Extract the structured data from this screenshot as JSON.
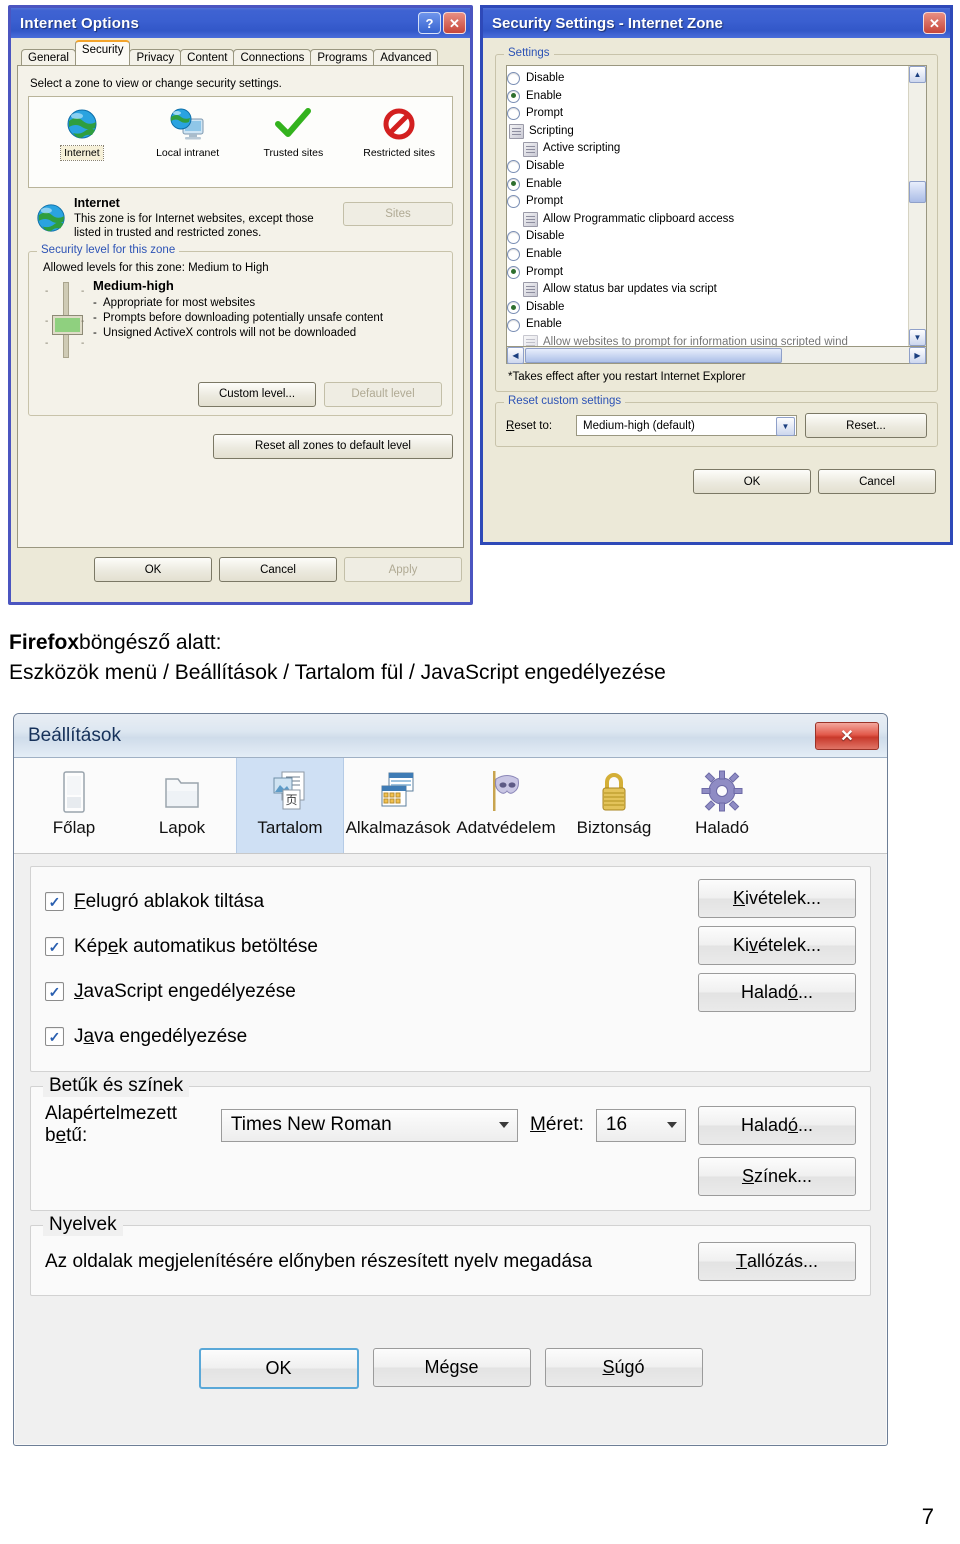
{
  "ie_options": {
    "title": "Internet Options",
    "help_button": "?",
    "close_button": "✕",
    "tabs": [
      {
        "label": "General",
        "active": false
      },
      {
        "label": "Security",
        "active": true
      },
      {
        "label": "Privacy",
        "active": false
      },
      {
        "label": "Content",
        "active": false
      },
      {
        "label": "Connections",
        "active": false
      },
      {
        "label": "Programs",
        "active": false
      },
      {
        "label": "Advanced",
        "active": false
      }
    ],
    "hint": "Select a zone to view or change security settings.",
    "zones": [
      {
        "label": "Internet",
        "icon": "globe-icon",
        "selected": true
      },
      {
        "label": "Local intranet",
        "icon": "globe-monitor-icon",
        "selected": false
      },
      {
        "label": "Trusted sites",
        "icon": "green-check-icon",
        "selected": false
      },
      {
        "label": "Restricted sites",
        "icon": "red-prohibited-icon",
        "selected": false
      }
    ],
    "zone_detail": {
      "name": "Internet",
      "description": "This zone is for Internet websites, except those listed in trusted and restricted zones.",
      "sites_button": "Sites"
    },
    "security_level": {
      "group_title": "Security level for this zone",
      "allowed": "Allowed levels for this zone: Medium to High",
      "level_name": "Medium-high",
      "bullets": [
        "Appropriate for most websites",
        "Prompts before downloading potentially unsafe content",
        "Unsigned ActiveX controls will not be downloaded"
      ],
      "custom_level_button": "Custom level...",
      "default_level_button": "Default level",
      "reset_all_button": "Reset all zones to default level"
    },
    "footer": {
      "ok": "OK",
      "cancel": "Cancel",
      "apply": "Apply"
    }
  },
  "security_settings": {
    "title": "Security Settings - Internet Zone",
    "close_button": "✕",
    "settings_group_title": "Settings",
    "rows": [
      {
        "type": "radio",
        "label": "Disable",
        "checked": false,
        "indent": 1
      },
      {
        "type": "radio",
        "label": "Enable",
        "checked": true,
        "indent": 1
      },
      {
        "type": "radio",
        "label": "Prompt",
        "checked": false,
        "indent": 1
      },
      {
        "type": "category",
        "label": "Scripting",
        "indent": 0
      },
      {
        "type": "category",
        "label": "Active scripting",
        "indent": 1
      },
      {
        "type": "radio",
        "label": "Disable",
        "checked": false,
        "indent": 1
      },
      {
        "type": "radio",
        "label": "Enable",
        "checked": true,
        "indent": 1
      },
      {
        "type": "radio",
        "label": "Prompt",
        "checked": false,
        "indent": 1
      },
      {
        "type": "category",
        "label": "Allow Programmatic clipboard access",
        "indent": 1
      },
      {
        "type": "radio",
        "label": "Disable",
        "checked": false,
        "indent": 1
      },
      {
        "type": "radio",
        "label": "Enable",
        "checked": false,
        "indent": 1
      },
      {
        "type": "radio",
        "label": "Prompt",
        "checked": true,
        "indent": 1
      },
      {
        "type": "category",
        "label": "Allow status bar updates via script",
        "indent": 1
      },
      {
        "type": "radio",
        "label": "Disable",
        "checked": true,
        "indent": 1
      },
      {
        "type": "radio",
        "label": "Enable",
        "checked": false,
        "indent": 1
      },
      {
        "type": "category",
        "label": "Allow websites to prompt for information using scripted wind",
        "indent": 1
      }
    ],
    "note": "*Takes effect after you restart Internet Explorer",
    "reset_group_title": "Reset custom settings",
    "reset_to_label": "Reset to:",
    "reset_to_value": "Medium-high (default)",
    "reset_button": "Reset...",
    "ok": "OK",
    "cancel": "Cancel"
  },
  "caption": {
    "bold": "Firefox",
    "line1_rest": "böngésző alatt:",
    "line2": "Eszközök menü / Beállítások / Tartalom fül / JavaScript engedélyezése"
  },
  "firefox_options": {
    "title": "Beállítások",
    "close_button": "✕",
    "tabs": [
      {
        "label": "Főlap",
        "icon": "home-page-icon",
        "selected": false
      },
      {
        "label": "Lapok",
        "icon": "tabs-folder-icon",
        "selected": false
      },
      {
        "label": "Tartalom",
        "icon": "content-pages-icon",
        "selected": true
      },
      {
        "label": "Alkalmazások",
        "icon": "applications-window-icon",
        "selected": false
      },
      {
        "label": "Adatvédelem",
        "icon": "privacy-mask-icon",
        "selected": false
      },
      {
        "label": "Biztonság",
        "icon": "security-padlock-icon",
        "selected": false
      },
      {
        "label": "Haladó",
        "icon": "advanced-gear-icon",
        "selected": false
      }
    ],
    "checkboxes": [
      {
        "pre": "F",
        "key": "",
        "label_before": "",
        "label": "Felugró ablakok tiltása",
        "accesskey_index": 0,
        "checked": true,
        "button": "Kivételek...",
        "button_accesskey_index": 1
      },
      {
        "label": "Képek automatikus betöltése",
        "accesskey_index": 3,
        "checked": true,
        "button": "Kivételek...",
        "button_accesskey_index": 2
      },
      {
        "label": "JavaScript engedélyezése",
        "accesskey_index": 0,
        "checked": true,
        "button": "Haladó...",
        "button_accesskey_index": 4
      },
      {
        "label": "Java engedélyezése",
        "accesskey_index": 1,
        "checked": true,
        "button": "",
        "button_accesskey_index": -1
      }
    ],
    "fonts_group": {
      "title": "Betűk és színek",
      "default_font_label": "Alapértelmezett betű:",
      "default_font_accesskey_index": 16,
      "default_font_value": "Times New Roman",
      "size_label": "Méret:",
      "size_accesskey_index": 0,
      "size_value": "16",
      "advanced_button": "Haladó...",
      "advanced_accesskey_index": 4,
      "colors_button": "Színek...",
      "colors_accesskey_index": 0
    },
    "languages_group": {
      "title": "Nyelvek",
      "text": "Az oldalak megjelenítésére előnyben részesített nyelv megadása",
      "browse_button": "Tallózás...",
      "browse_accesskey_index": 0
    },
    "footer": {
      "ok": "OK",
      "cancel": "Mégse",
      "help": "Súgó",
      "help_accesskey_index": 0
    }
  },
  "page_number": "7",
  "colors": {
    "xp_title_blue": "#3a5fd0",
    "xp_face": "#ece9d8",
    "group_label_blue": "#2d53b5",
    "selected_tab_orange": "#f3a42b",
    "ff_selected_tab": "#cfe0f4",
    "close_red": "#c8392b",
    "radio_dot_green": "#2e6f2e"
  }
}
